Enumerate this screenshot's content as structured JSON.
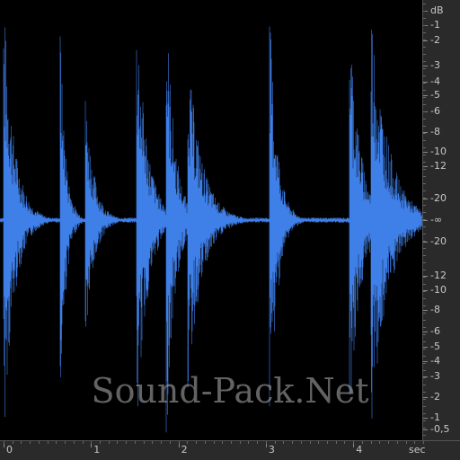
{
  "waveform": {
    "color": "#3f7fe8",
    "background": "#000000",
    "hits": [
      {
        "time": 0.0,
        "amplitude": 1.0,
        "decay": 0.35
      },
      {
        "time": 0.64,
        "amplitude": 1.0,
        "decay": 0.18
      },
      {
        "time": 0.93,
        "amplitude": 0.62,
        "decay": 0.28
      },
      {
        "time": 1.52,
        "amplitude": 1.0,
        "decay": 0.35
      },
      {
        "time": 1.86,
        "amplitude": 1.0,
        "decay": 0.28
      },
      {
        "time": 2.1,
        "amplitude": 0.82,
        "decay": 0.45
      },
      {
        "time": 3.04,
        "amplitude": 1.0,
        "decay": 0.25
      },
      {
        "time": 3.95,
        "amplitude": 1.0,
        "decay": 0.35
      },
      {
        "time": 4.2,
        "amplitude": 1.0,
        "decay": 0.55
      }
    ]
  },
  "db_ruler": {
    "labels": [
      "dB",
      "-1",
      "-2",
      "-3",
      "-4",
      "-5",
      "-6",
      "-8",
      "-10",
      "-12",
      "-20",
      "-∞",
      "-20",
      "-12",
      "-10",
      "-8",
      "-6",
      "-5",
      "-4",
      "-3",
      "-2",
      "-1",
      "-0,5"
    ]
  },
  "time_ruler": {
    "labels": [
      "0",
      "1",
      "2",
      "3",
      "4",
      "sec"
    ]
  },
  "watermark": "Sound-Pack.Net"
}
